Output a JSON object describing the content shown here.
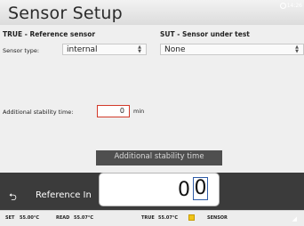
{
  "window": {
    "title": "Sensor Setup",
    "clock": "14:26"
  },
  "reference": {
    "heading": "TRUE - Reference sensor",
    "sensor_type_label": "Sensor type:",
    "sensor_type_value": "internal"
  },
  "sut": {
    "heading": "SUT - Sensor under test",
    "sensor_type_value": "None"
  },
  "stability": {
    "label": "Additional stability time:",
    "value": "0",
    "unit": "min"
  },
  "numpad": {
    "title": "Additional stability time",
    "digits": [
      "0",
      "0"
    ]
  },
  "footer": {
    "back_label": "Reference In"
  },
  "status": {
    "set_label": "SET",
    "set_value": "55.00°C",
    "read_label": "READ",
    "read_value": "55.07°C",
    "true_label": "TRUE",
    "true_value": "55.07°C",
    "sensor_label": "SENSOR",
    "swatch_color": "#f0c419"
  }
}
